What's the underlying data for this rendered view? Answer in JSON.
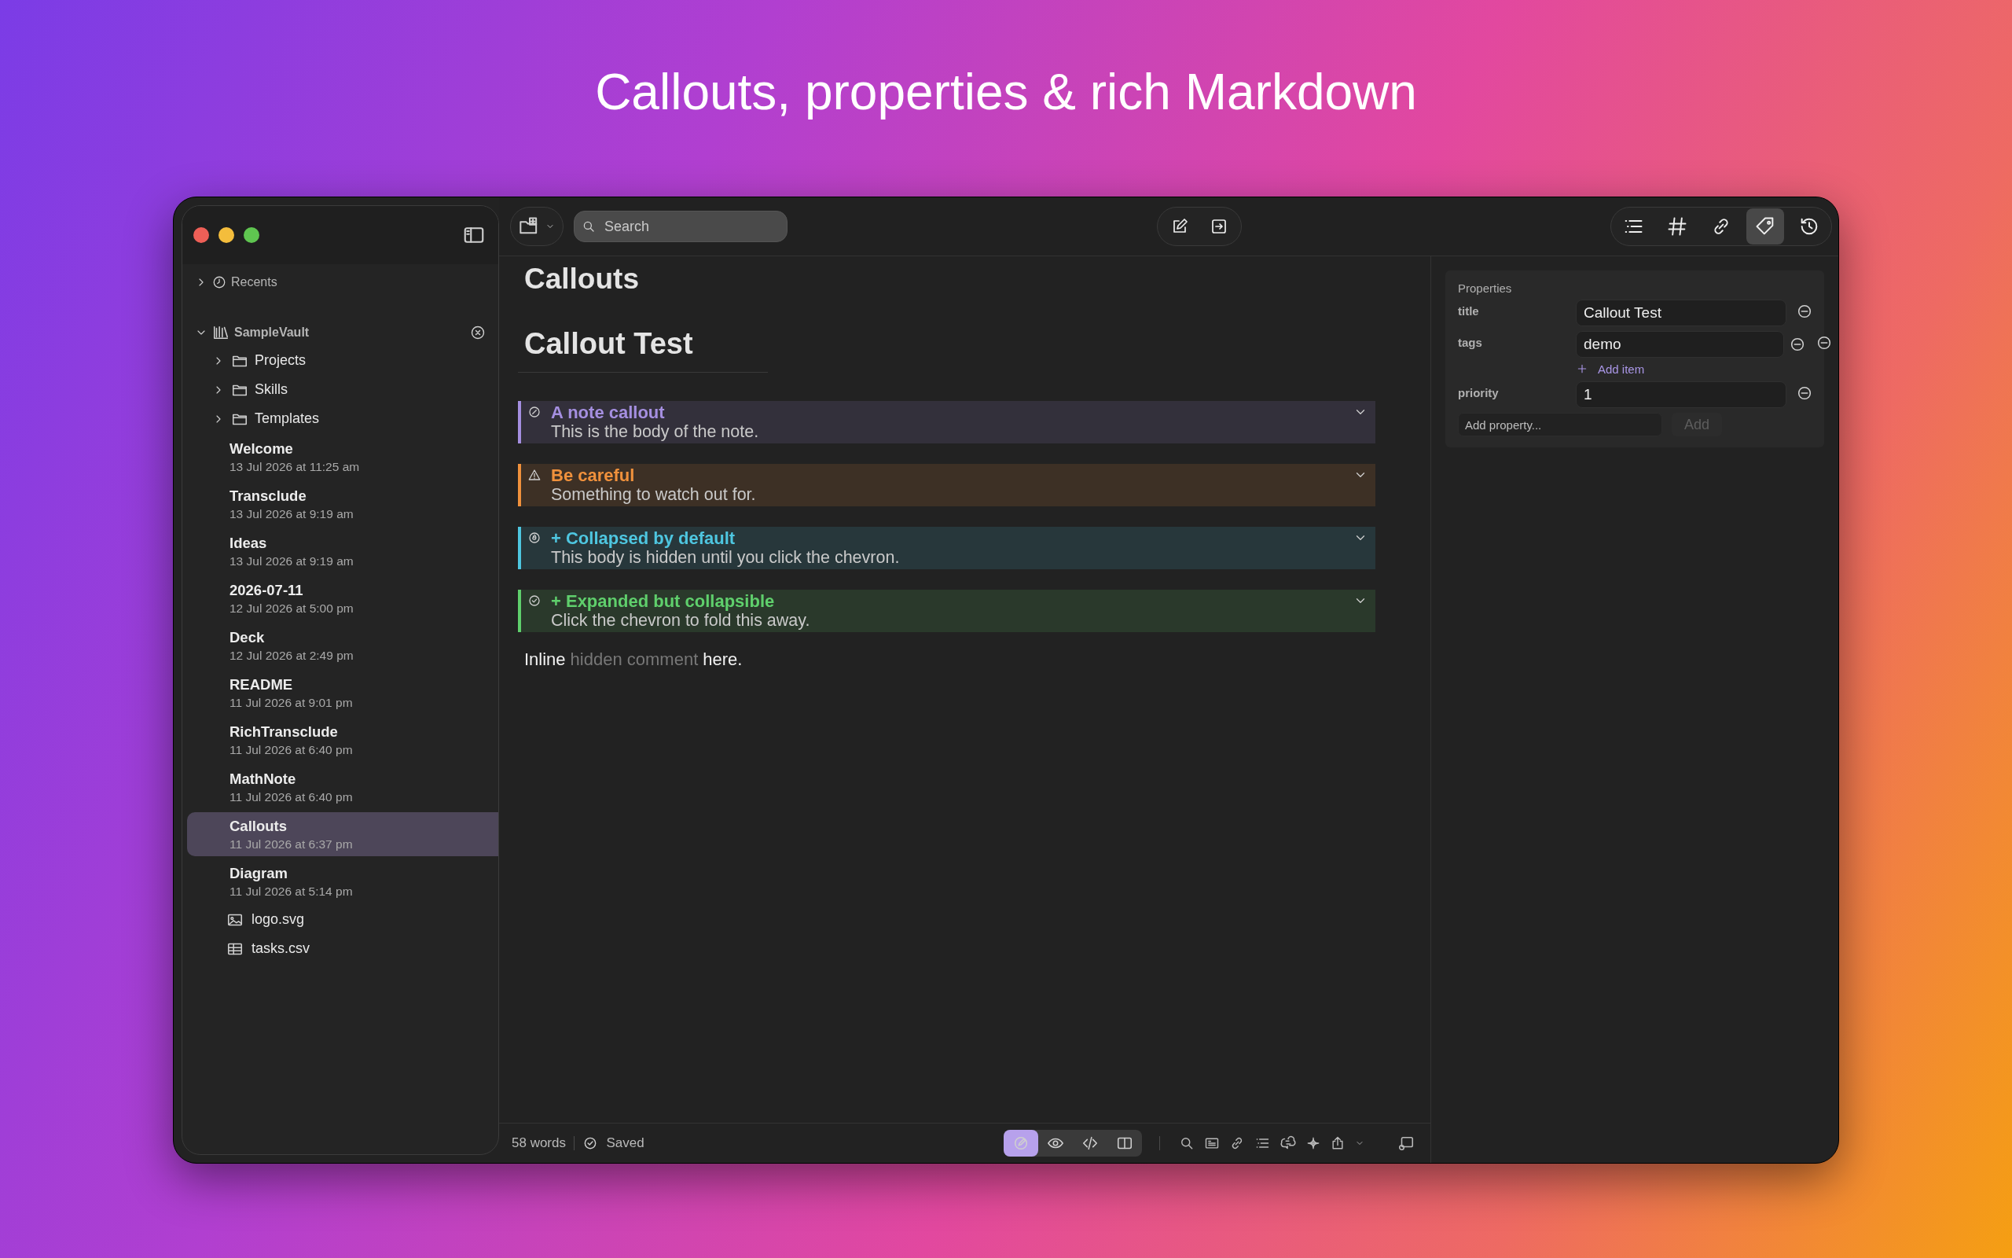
{
  "headline": "Callouts, properties & rich Markdown",
  "sidebar": {
    "recents": {
      "label": "Recents",
      "expanded": false
    },
    "vault": {
      "name": "SampleVault",
      "expanded": true,
      "children": [
        {
          "kind": "folder",
          "name": "Projects",
          "expanded": false,
          "selected": false
        },
        {
          "kind": "folder",
          "name": "Skills",
          "expanded": false,
          "selected": false
        },
        {
          "kind": "folder",
          "name": "Templates",
          "expanded": false,
          "selected": false
        },
        {
          "kind": "note",
          "name": "Welcome",
          "date": "13 Jul 2026 at 11:25 am",
          "selected": false
        },
        {
          "kind": "note",
          "name": "Transclude",
          "date": "13 Jul 2026 at 9:19 am",
          "selected": false
        },
        {
          "kind": "note",
          "name": "Ideas",
          "date": "13 Jul 2026 at 9:19 am",
          "selected": false
        },
        {
          "kind": "note",
          "name": "2026-07-11",
          "date": "12 Jul 2026 at 5:00 pm",
          "selected": false
        },
        {
          "kind": "note",
          "name": "Deck",
          "date": "12 Jul 2026 at 2:49 pm",
          "selected": false
        },
        {
          "kind": "note",
          "name": "README",
          "date": "11 Jul 2026 at 9:01 pm",
          "selected": false
        },
        {
          "kind": "note",
          "name": "RichTransclude",
          "date": "11 Jul 2026 at 6:40 pm",
          "selected": false
        },
        {
          "kind": "note",
          "name": "MathNote",
          "date": "11 Jul 2026 at 6:40 pm",
          "selected": false
        },
        {
          "kind": "note",
          "name": "Callouts",
          "date": "11 Jul 2026 at 6:37 pm",
          "selected": true
        },
        {
          "kind": "note",
          "name": "Diagram",
          "date": "11 Jul 2026 at 5:14 pm",
          "selected": false
        },
        {
          "kind": "image",
          "name": "logo.svg",
          "selected": false
        },
        {
          "kind": "table",
          "name": "tasks.csv",
          "selected": false
        }
      ]
    }
  },
  "toolbar": {
    "search": {
      "placeholder": "Search"
    },
    "inspector_tabs": [
      {
        "kind": "outline",
        "selected": false
      },
      {
        "kind": "tags",
        "selected": false
      },
      {
        "kind": "links",
        "selected": false
      },
      {
        "kind": "properties",
        "selected": true
      },
      {
        "kind": "history",
        "selected": false
      }
    ]
  },
  "document": {
    "title": "Callouts",
    "heading": "Callout Test",
    "callouts": [
      {
        "kind": "note",
        "title": "A note callout",
        "body": "This is the body of the note.",
        "color": "#a58fe0"
      },
      {
        "kind": "warning",
        "title": "Be careful",
        "body": "Something to watch out for.",
        "color": "#f0913c"
      },
      {
        "kind": "tip",
        "title": "+ Collapsed by default",
        "body": "This body is hidden until you click the chevron.",
        "color": "#4ec6e0"
      },
      {
        "kind": "success",
        "title": "+ Expanded but collapsible",
        "body": "Click the chevron to fold this away.",
        "color": "#5fcf6c"
      }
    ],
    "paragraph": [
      {
        "kind": "text",
        "text": "Inline"
      },
      {
        "kind": "comment",
        "text": "hidden comment"
      },
      {
        "kind": "text",
        "text": "here."
      }
    ]
  },
  "properties": {
    "heading": "Properties",
    "rows": [
      {
        "key": "title",
        "kind": "text",
        "values": [
          "Callout Test"
        ]
      },
      {
        "key": "tags",
        "kind": "list",
        "values": [
          "demo"
        ],
        "add_label": "Add item"
      },
      {
        "key": "priority",
        "kind": "text",
        "values": [
          "1"
        ]
      }
    ],
    "add_placeholder": "Add property...",
    "add_button": {
      "label": "Add",
      "disabled": true
    }
  },
  "status_bar": {
    "words": "58 words",
    "save_state": "Saved",
    "modes": [
      {
        "kind": "edit",
        "selected": true
      },
      {
        "kind": "preview",
        "selected": false
      },
      {
        "kind": "source",
        "selected": false
      },
      {
        "kind": "split",
        "selected": false
      }
    ]
  }
}
